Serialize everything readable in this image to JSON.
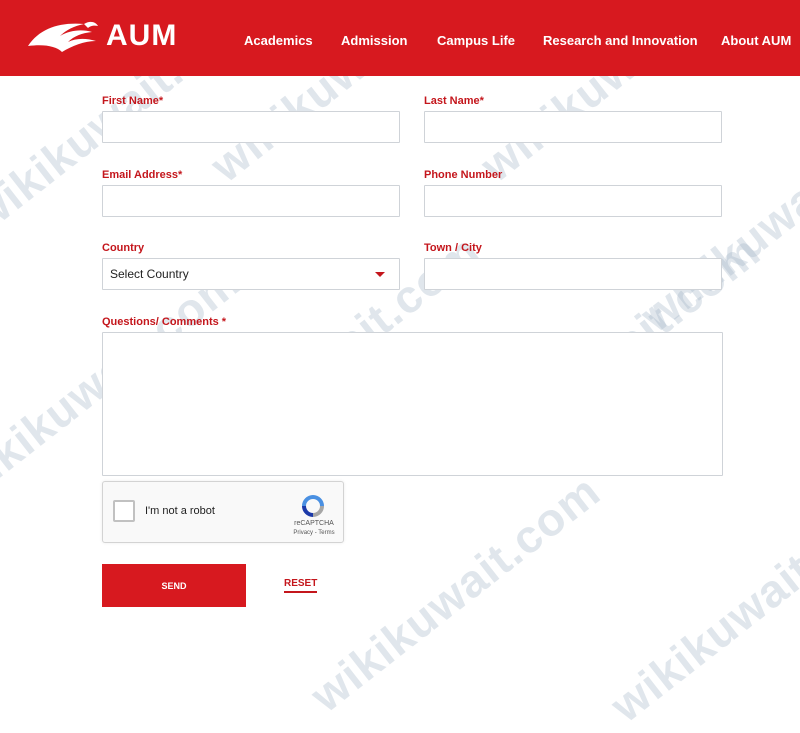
{
  "header": {
    "logo_text": "AUM",
    "nav": [
      "Academics",
      "Admission",
      "Campus Life",
      "Research and Innovation",
      "About AUM"
    ]
  },
  "form": {
    "first_name_label": "First Name*",
    "last_name_label": "Last Name*",
    "email_label": "Email Address*",
    "phone_label": "Phone Number",
    "country_label": "Country",
    "country_selected": "Select Country",
    "town_label": "Town / City",
    "comments_label": "Questions/ Comments *",
    "captcha_label": "I'm not a robot",
    "captcha_brand": "reCAPTCHA",
    "captcha_terms": "Privacy - Terms",
    "send_label": "SEND",
    "reset_label": "RESET"
  },
  "watermark": "wikikuwait.com",
  "colors": {
    "brand_red": "#d7191f",
    "label_red": "#c4161c"
  }
}
